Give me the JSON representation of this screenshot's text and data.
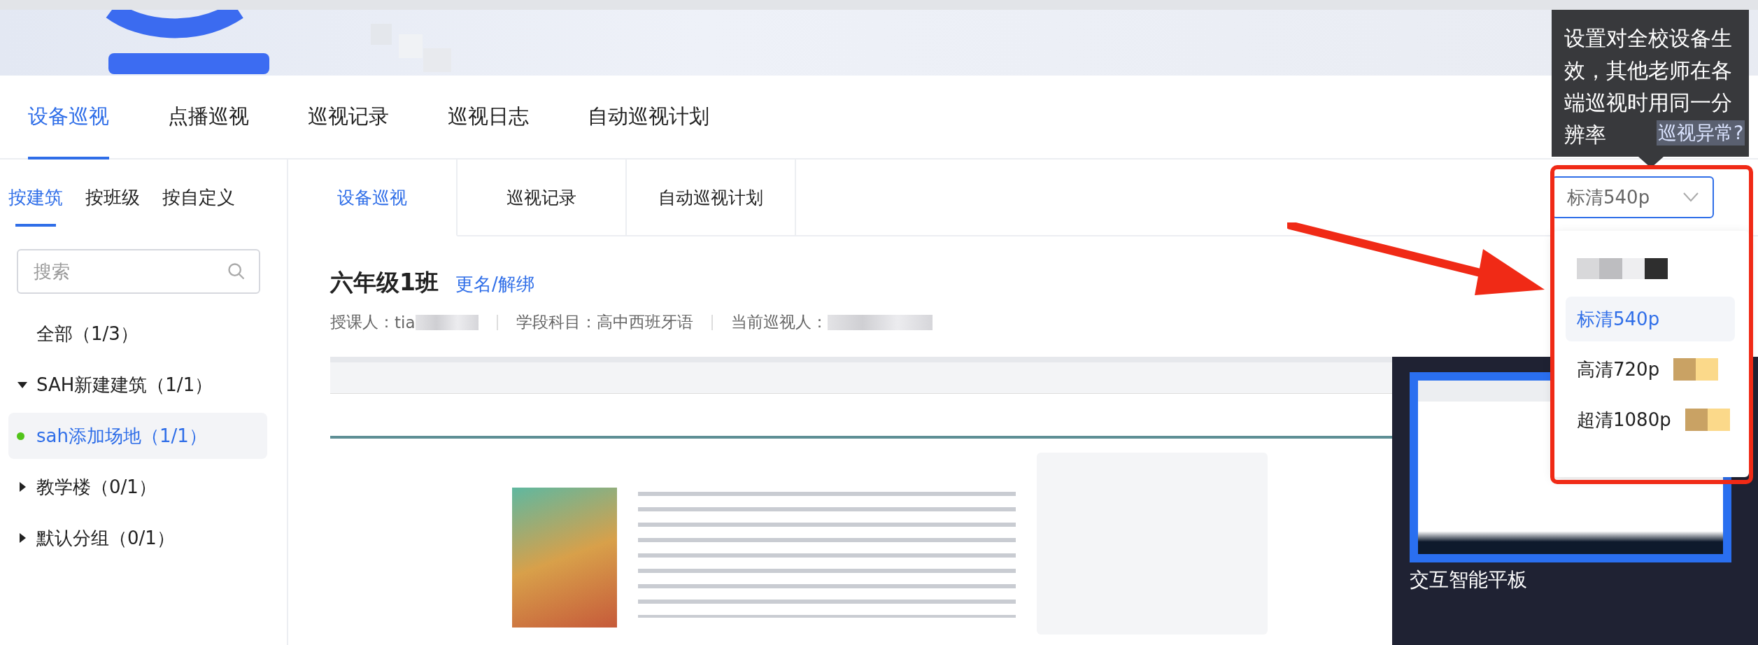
{
  "top_tabs": [
    {
      "label": "设备巡视",
      "selected": true
    },
    {
      "label": "点播巡视",
      "selected": false
    },
    {
      "label": "巡视记录",
      "selected": false
    },
    {
      "label": "巡视日志",
      "selected": false
    },
    {
      "label": "自动巡视计划",
      "selected": false
    }
  ],
  "help_link": "巡视异常?",
  "sidebar": {
    "tabs": [
      {
        "label": "按建筑",
        "selected": true
      },
      {
        "label": "按班级",
        "selected": false
      },
      {
        "label": "按自定义",
        "selected": false
      }
    ],
    "search": {
      "placeholder": "搜索"
    },
    "tree": [
      {
        "label": "全部（1/3）",
        "selected": false
      },
      {
        "label": "SAH新建建筑（1/1）",
        "selected": false,
        "expanded": true,
        "children": [
          {
            "label": "sah添加场地（1/1）",
            "selected": true,
            "online": true
          }
        ]
      },
      {
        "label": "教学楼（0/1）",
        "selected": false,
        "expanded": false
      },
      {
        "label": "默认分组（0/1）",
        "selected": false,
        "expanded": false
      }
    ]
  },
  "sub_tabs": [
    {
      "label": "设备巡视",
      "selected": true
    },
    {
      "label": "巡视记录",
      "selected": false
    },
    {
      "label": "自动巡视计划",
      "selected": false
    }
  ],
  "resolution": {
    "value": "标清540p",
    "options": [
      {
        "kind": "redacted",
        "selected": false
      },
      {
        "kind": "plain",
        "label": "标清540p",
        "selected": true
      },
      {
        "kind": "badged",
        "label": "高清720p",
        "selected": false
      },
      {
        "kind": "badged",
        "label": "超清1080p",
        "selected": false
      }
    ]
  },
  "tooltip": "设置对全校设备生效，其他老师在各端巡视时用同一分辨率",
  "room": {
    "title": "六年级1班",
    "rename_link": "更名/解绑",
    "teacher_label": "授课人：",
    "teacher_value": "tia",
    "subject": "学段科目：高中西班牙语",
    "inspector_label": "当前巡视人："
  },
  "devices": [
    {
      "name": "交互智能平板"
    }
  ]
}
